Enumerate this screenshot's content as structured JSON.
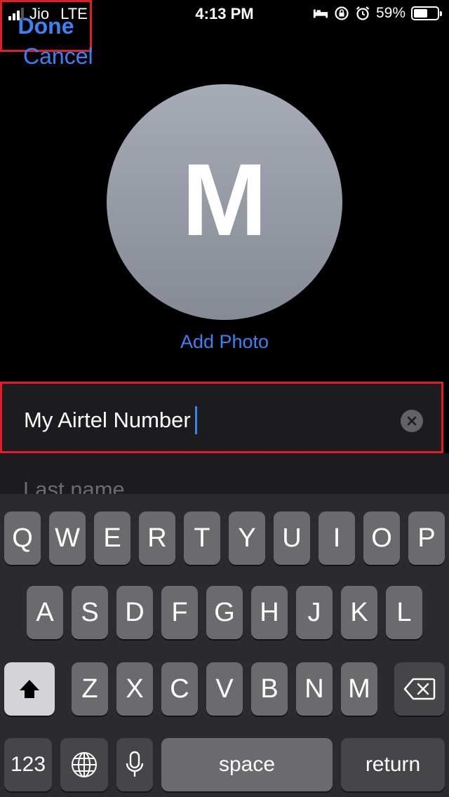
{
  "status_bar": {
    "carrier": "Jio",
    "network": "LTE",
    "time": "4:13 PM",
    "battery": "59%",
    "battery_level": 0.59
  },
  "nav": {
    "cancel_label": "Cancel",
    "done_label": "Done"
  },
  "avatar": {
    "initial": "M",
    "add_photo_label": "Add Photo"
  },
  "form": {
    "first_name_value": "My Airtel Number",
    "last_name_placeholder": "Last name"
  },
  "keyboard": {
    "row1": [
      "Q",
      "W",
      "E",
      "R",
      "T",
      "Y",
      "U",
      "I",
      "O",
      "P"
    ],
    "row2": [
      "A",
      "S",
      "D",
      "F",
      "G",
      "H",
      "J",
      "K",
      "L"
    ],
    "row3": [
      "Z",
      "X",
      "C",
      "V",
      "B",
      "N",
      "M"
    ],
    "numbers_label": "123",
    "space_label": "space",
    "return_label": "return"
  },
  "colors": {
    "accent": "#3b82f6",
    "highlight": "#e11d2a"
  }
}
